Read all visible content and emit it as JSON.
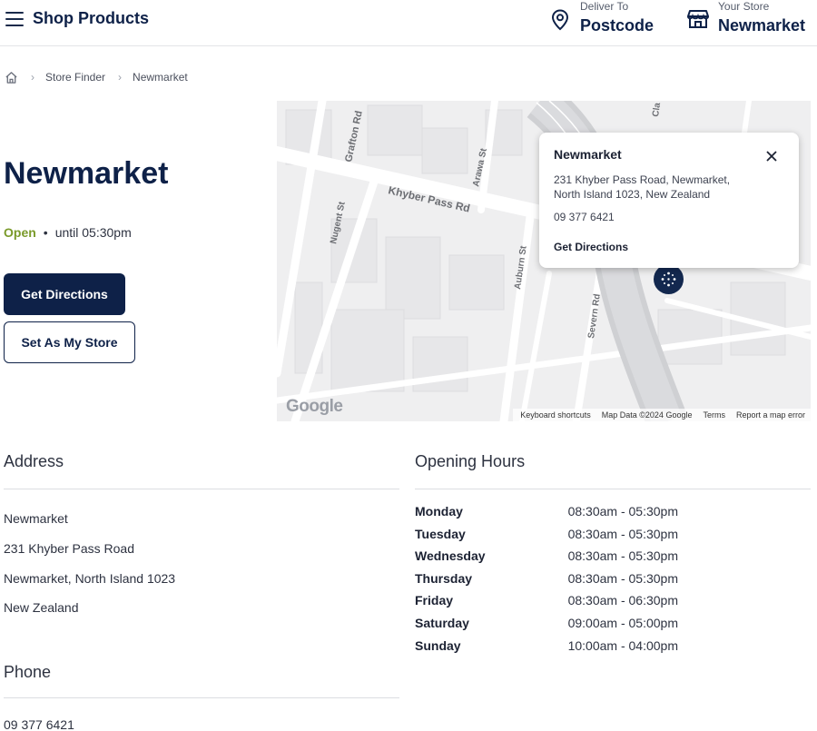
{
  "header": {
    "title": "Shop Products",
    "deliver_label": "Deliver To",
    "deliver_value": "Postcode",
    "store_label": "Your Store",
    "store_value": "Newmarket"
  },
  "breadcrumb": {
    "items": [
      "Store Finder",
      "Newmarket"
    ]
  },
  "store": {
    "name": "Newmarket",
    "status": "Open",
    "until": "until 05:30pm",
    "directions_button": "Get Directions",
    "set_store_button": "Set As My Store"
  },
  "map": {
    "streets": [
      "Grafton Rd",
      "Khyber Pass Rd",
      "Arawa St",
      "Nugent St",
      "Auburn St",
      "Severn Rd",
      "Cla"
    ],
    "popup": {
      "title": "Newmarket",
      "address_line1": "231 Khyber Pass Road, Newmarket,",
      "address_line2": "North Island 1023, New Zealand",
      "phone": "09 377 6421",
      "directions": "Get Directions"
    },
    "logo": "Google",
    "footer": [
      "Keyboard shortcuts",
      "Map Data ©2024 Google",
      "Terms",
      "Report a map error"
    ]
  },
  "address": {
    "title": "Address",
    "lines": [
      "Newmarket",
      "231 Khyber Pass Road",
      "Newmarket, North Island 1023",
      "New Zealand"
    ]
  },
  "hours": {
    "title": "Opening Hours",
    "rows": [
      {
        "day": "Monday",
        "time": "08:30am - 05:30pm"
      },
      {
        "day": "Tuesday",
        "time": "08:30am - 05:30pm"
      },
      {
        "day": "Wednesday",
        "time": "08:30am - 05:30pm"
      },
      {
        "day": "Thursday",
        "time": "08:30am - 05:30pm"
      },
      {
        "day": "Friday",
        "time": "08:30am - 06:30pm"
      },
      {
        "day": "Saturday",
        "time": "09:00am - 05:00pm"
      },
      {
        "day": "Sunday",
        "time": "10:00am - 04:00pm"
      }
    ]
  },
  "phone": {
    "title": "Phone",
    "number": "09 377 6421"
  },
  "colors": {
    "brand_navy": "#0e2148",
    "open_green": "#7a9a2a"
  }
}
